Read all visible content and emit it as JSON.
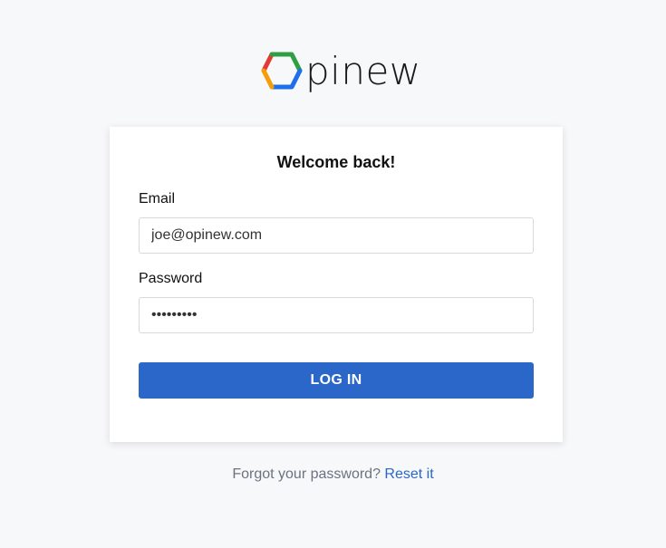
{
  "brand": {
    "logo_text": "pinew",
    "logo_icon": "hexagon-logo-icon",
    "logo_colors": [
      "#2ea043",
      "#1f6feb",
      "#e53935",
      "#f59e0b"
    ]
  },
  "login": {
    "title": "Welcome back!",
    "email_label": "Email",
    "email_value": "joe@opinew.com",
    "password_label": "Password",
    "password_value": "password1",
    "submit_label": "LOG IN"
  },
  "footer": {
    "forgot_text": "Forgot your password?",
    "reset_link": "Reset it"
  },
  "colors": {
    "accent": "#2b66c9",
    "background": "#f7f8fa",
    "muted_text": "#6b7280"
  }
}
